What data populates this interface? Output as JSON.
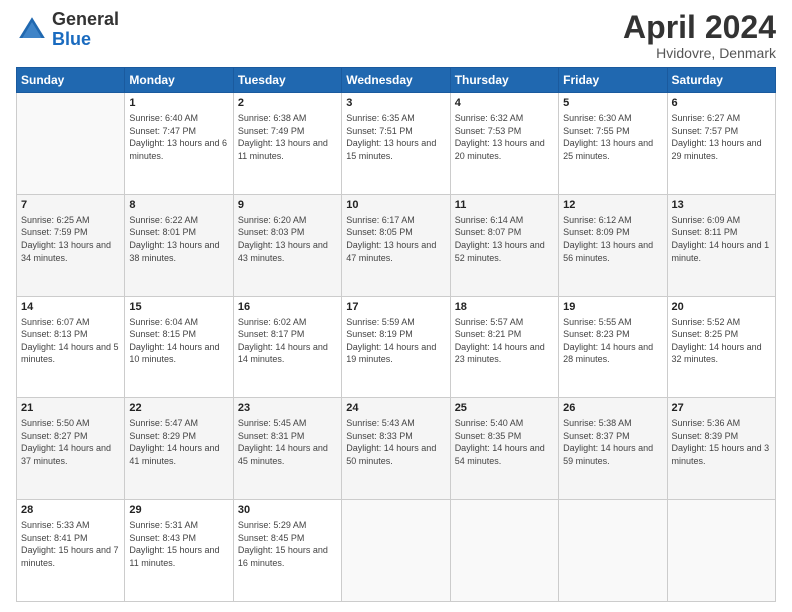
{
  "logo": {
    "general": "General",
    "blue": "Blue"
  },
  "title": "April 2024",
  "subtitle": "Hvidovre, Denmark",
  "days_header": [
    "Sunday",
    "Monday",
    "Tuesday",
    "Wednesday",
    "Thursday",
    "Friday",
    "Saturday"
  ],
  "weeks": [
    [
      {
        "day": "",
        "sunrise": "",
        "sunset": "",
        "daylight": ""
      },
      {
        "day": "1",
        "sunrise": "Sunrise: 6:40 AM",
        "sunset": "Sunset: 7:47 PM",
        "daylight": "Daylight: 13 hours and 6 minutes."
      },
      {
        "day": "2",
        "sunrise": "Sunrise: 6:38 AM",
        "sunset": "Sunset: 7:49 PM",
        "daylight": "Daylight: 13 hours and 11 minutes."
      },
      {
        "day": "3",
        "sunrise": "Sunrise: 6:35 AM",
        "sunset": "Sunset: 7:51 PM",
        "daylight": "Daylight: 13 hours and 15 minutes."
      },
      {
        "day": "4",
        "sunrise": "Sunrise: 6:32 AM",
        "sunset": "Sunset: 7:53 PM",
        "daylight": "Daylight: 13 hours and 20 minutes."
      },
      {
        "day": "5",
        "sunrise": "Sunrise: 6:30 AM",
        "sunset": "Sunset: 7:55 PM",
        "daylight": "Daylight: 13 hours and 25 minutes."
      },
      {
        "day": "6",
        "sunrise": "Sunrise: 6:27 AM",
        "sunset": "Sunset: 7:57 PM",
        "daylight": "Daylight: 13 hours and 29 minutes."
      }
    ],
    [
      {
        "day": "7",
        "sunrise": "Sunrise: 6:25 AM",
        "sunset": "Sunset: 7:59 PM",
        "daylight": "Daylight: 13 hours and 34 minutes."
      },
      {
        "day": "8",
        "sunrise": "Sunrise: 6:22 AM",
        "sunset": "Sunset: 8:01 PM",
        "daylight": "Daylight: 13 hours and 38 minutes."
      },
      {
        "day": "9",
        "sunrise": "Sunrise: 6:20 AM",
        "sunset": "Sunset: 8:03 PM",
        "daylight": "Daylight: 13 hours and 43 minutes."
      },
      {
        "day": "10",
        "sunrise": "Sunrise: 6:17 AM",
        "sunset": "Sunset: 8:05 PM",
        "daylight": "Daylight: 13 hours and 47 minutes."
      },
      {
        "day": "11",
        "sunrise": "Sunrise: 6:14 AM",
        "sunset": "Sunset: 8:07 PM",
        "daylight": "Daylight: 13 hours and 52 minutes."
      },
      {
        "day": "12",
        "sunrise": "Sunrise: 6:12 AM",
        "sunset": "Sunset: 8:09 PM",
        "daylight": "Daylight: 13 hours and 56 minutes."
      },
      {
        "day": "13",
        "sunrise": "Sunrise: 6:09 AM",
        "sunset": "Sunset: 8:11 PM",
        "daylight": "Daylight: 14 hours and 1 minute."
      }
    ],
    [
      {
        "day": "14",
        "sunrise": "Sunrise: 6:07 AM",
        "sunset": "Sunset: 8:13 PM",
        "daylight": "Daylight: 14 hours and 5 minutes."
      },
      {
        "day": "15",
        "sunrise": "Sunrise: 6:04 AM",
        "sunset": "Sunset: 8:15 PM",
        "daylight": "Daylight: 14 hours and 10 minutes."
      },
      {
        "day": "16",
        "sunrise": "Sunrise: 6:02 AM",
        "sunset": "Sunset: 8:17 PM",
        "daylight": "Daylight: 14 hours and 14 minutes."
      },
      {
        "day": "17",
        "sunrise": "Sunrise: 5:59 AM",
        "sunset": "Sunset: 8:19 PM",
        "daylight": "Daylight: 14 hours and 19 minutes."
      },
      {
        "day": "18",
        "sunrise": "Sunrise: 5:57 AM",
        "sunset": "Sunset: 8:21 PM",
        "daylight": "Daylight: 14 hours and 23 minutes."
      },
      {
        "day": "19",
        "sunrise": "Sunrise: 5:55 AM",
        "sunset": "Sunset: 8:23 PM",
        "daylight": "Daylight: 14 hours and 28 minutes."
      },
      {
        "day": "20",
        "sunrise": "Sunrise: 5:52 AM",
        "sunset": "Sunset: 8:25 PM",
        "daylight": "Daylight: 14 hours and 32 minutes."
      }
    ],
    [
      {
        "day": "21",
        "sunrise": "Sunrise: 5:50 AM",
        "sunset": "Sunset: 8:27 PM",
        "daylight": "Daylight: 14 hours and 37 minutes."
      },
      {
        "day": "22",
        "sunrise": "Sunrise: 5:47 AM",
        "sunset": "Sunset: 8:29 PM",
        "daylight": "Daylight: 14 hours and 41 minutes."
      },
      {
        "day": "23",
        "sunrise": "Sunrise: 5:45 AM",
        "sunset": "Sunset: 8:31 PM",
        "daylight": "Daylight: 14 hours and 45 minutes."
      },
      {
        "day": "24",
        "sunrise": "Sunrise: 5:43 AM",
        "sunset": "Sunset: 8:33 PM",
        "daylight": "Daylight: 14 hours and 50 minutes."
      },
      {
        "day": "25",
        "sunrise": "Sunrise: 5:40 AM",
        "sunset": "Sunset: 8:35 PM",
        "daylight": "Daylight: 14 hours and 54 minutes."
      },
      {
        "day": "26",
        "sunrise": "Sunrise: 5:38 AM",
        "sunset": "Sunset: 8:37 PM",
        "daylight": "Daylight: 14 hours and 59 minutes."
      },
      {
        "day": "27",
        "sunrise": "Sunrise: 5:36 AM",
        "sunset": "Sunset: 8:39 PM",
        "daylight": "Daylight: 15 hours and 3 minutes."
      }
    ],
    [
      {
        "day": "28",
        "sunrise": "Sunrise: 5:33 AM",
        "sunset": "Sunset: 8:41 PM",
        "daylight": "Daylight: 15 hours and 7 minutes."
      },
      {
        "day": "29",
        "sunrise": "Sunrise: 5:31 AM",
        "sunset": "Sunset: 8:43 PM",
        "daylight": "Daylight: 15 hours and 11 minutes."
      },
      {
        "day": "30",
        "sunrise": "Sunrise: 5:29 AM",
        "sunset": "Sunset: 8:45 PM",
        "daylight": "Daylight: 15 hours and 16 minutes."
      },
      {
        "day": "",
        "sunrise": "",
        "sunset": "",
        "daylight": ""
      },
      {
        "day": "",
        "sunrise": "",
        "sunset": "",
        "daylight": ""
      },
      {
        "day": "",
        "sunrise": "",
        "sunset": "",
        "daylight": ""
      },
      {
        "day": "",
        "sunrise": "",
        "sunset": "",
        "daylight": ""
      }
    ]
  ]
}
